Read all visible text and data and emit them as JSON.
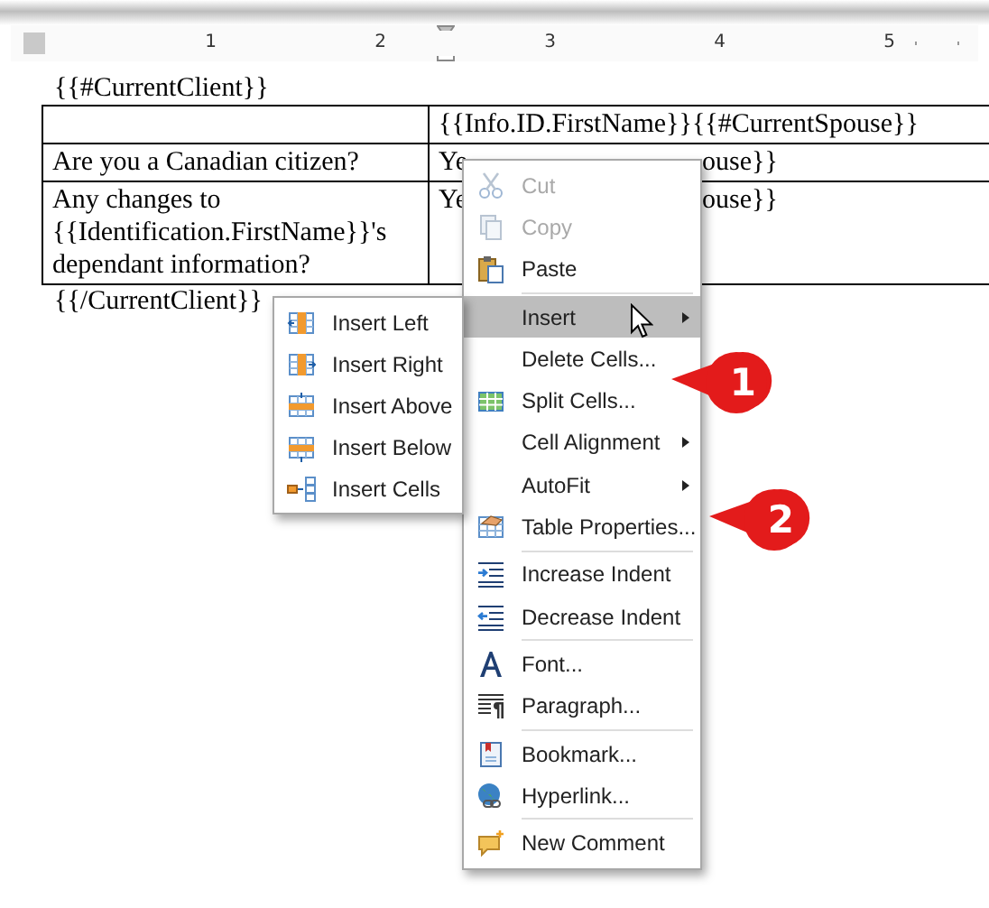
{
  "ruler": {
    "numbers": [
      "1",
      "2",
      "3",
      "4",
      "5"
    ]
  },
  "document": {
    "opening_tag": "{{#CurrentClient}}",
    "closing_tag": "{{/CurrentClient}}",
    "table": {
      "rows": [
        {
          "cells": [
            "",
            "{{Info.ID.FirstName}}{{#CurrentSpouse}}"
          ]
        },
        {
          "cells": [
            "Are you a Canadian citizen?",
            "Ye",
            "ouse}}"
          ]
        },
        {
          "cells": [
            "Any changes to {{Identification.FirstName}}'s dependant information?",
            "Ye",
            "ouse}}"
          ]
        }
      ]
    }
  },
  "context_menu": {
    "groups": [
      [
        {
          "label": "Cut",
          "disabled": true,
          "selected": false,
          "submenu": false
        },
        {
          "label": "Copy",
          "disabled": true,
          "selected": false,
          "submenu": false
        },
        {
          "label": "Paste",
          "disabled": false,
          "selected": false,
          "submenu": false
        }
      ],
      [
        {
          "label": "Insert",
          "disabled": false,
          "selected": true,
          "submenu": true
        },
        {
          "label": "Delete Cells...",
          "disabled": false,
          "selected": false,
          "submenu": false
        },
        {
          "label": "Split Cells...",
          "disabled": false,
          "selected": false,
          "submenu": false
        },
        {
          "label": "Cell Alignment",
          "disabled": false,
          "selected": false,
          "submenu": true
        },
        {
          "label": "AutoFit",
          "disabled": false,
          "selected": false,
          "submenu": true
        },
        {
          "label": "Table Properties...",
          "disabled": false,
          "selected": false,
          "submenu": false
        }
      ],
      [
        {
          "label": "Increase Indent",
          "disabled": false,
          "selected": false,
          "submenu": false
        },
        {
          "label": "Decrease Indent",
          "disabled": false,
          "selected": false,
          "submenu": false
        }
      ],
      [
        {
          "label": "Font...",
          "disabled": false,
          "selected": false,
          "submenu": false
        },
        {
          "label": "Paragraph...",
          "disabled": false,
          "selected": false,
          "submenu": false
        }
      ],
      [
        {
          "label": "Bookmark...",
          "disabled": false,
          "selected": false,
          "submenu": false
        },
        {
          "label": "Hyperlink...",
          "disabled": false,
          "selected": false,
          "submenu": false
        }
      ],
      [
        {
          "label": "New Comment",
          "disabled": false,
          "selected": false,
          "submenu": false
        }
      ]
    ]
  },
  "insert_submenu": {
    "items": [
      {
        "label": "Insert Left"
      },
      {
        "label": "Insert Right"
      },
      {
        "label": "Insert Above"
      },
      {
        "label": "Insert Below"
      },
      {
        "label": "Insert Cells"
      }
    ]
  },
  "callouts": [
    {
      "number": "1"
    },
    {
      "number": "2"
    }
  ]
}
